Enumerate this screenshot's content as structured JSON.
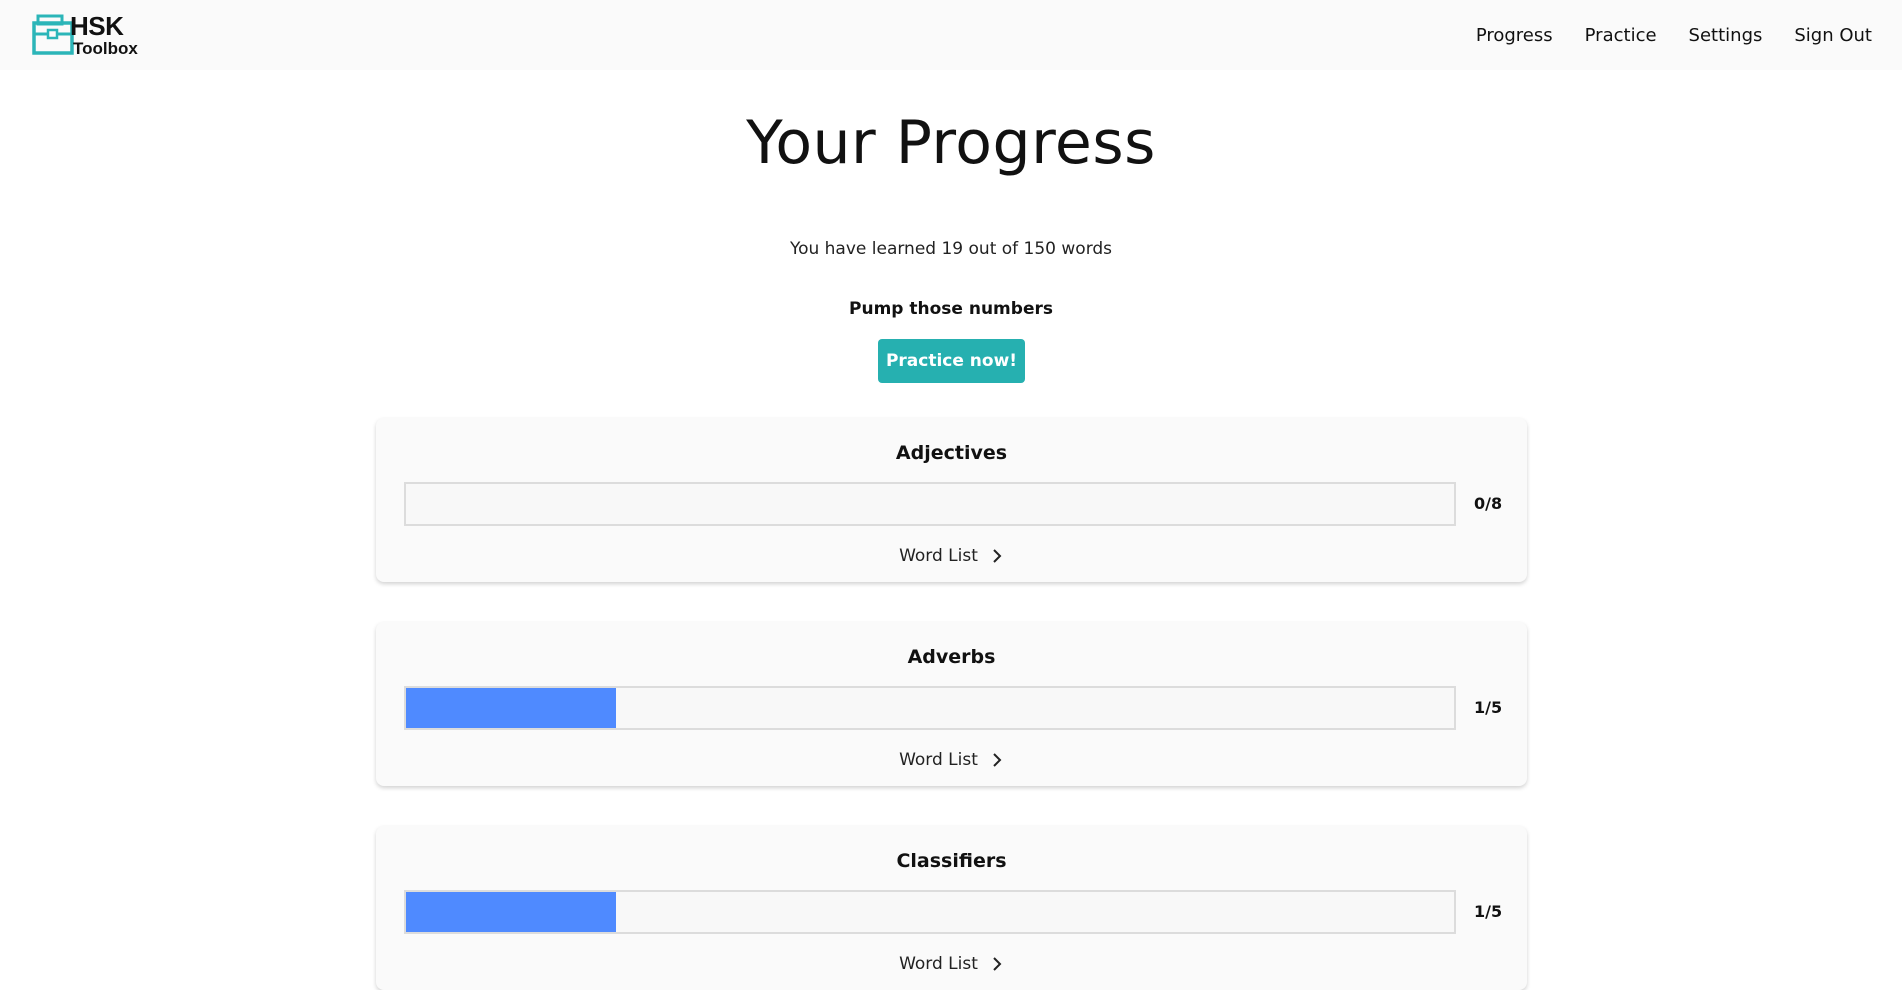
{
  "header": {
    "logo": {
      "line1": "HSK",
      "line2": "Toolbox"
    },
    "nav": [
      "Progress",
      "Practice",
      "Settings",
      "Sign Out"
    ]
  },
  "main": {
    "title": "Your Progress",
    "learned_text": "You have learned 19 out of 150 words",
    "motivation": "Pump those numbers",
    "practice_button": "Practice now!"
  },
  "categories": [
    {
      "name": "Adjectives",
      "count": "0/8",
      "progress": 0.0,
      "link": "Word List"
    },
    {
      "name": "Adverbs",
      "count": "1/5",
      "progress": 0.2,
      "link": "Word List"
    },
    {
      "name": "Classifiers",
      "count": "1/5",
      "progress": 0.2,
      "link": "Word List"
    }
  ],
  "colors": {
    "accent": "#26b0b0",
    "progress_fill": "#4f8aff",
    "logo_icon": "#2bb5b8"
  },
  "icons": {
    "logo": "toolbox-icon",
    "word_list": "chevron-right-icon"
  }
}
